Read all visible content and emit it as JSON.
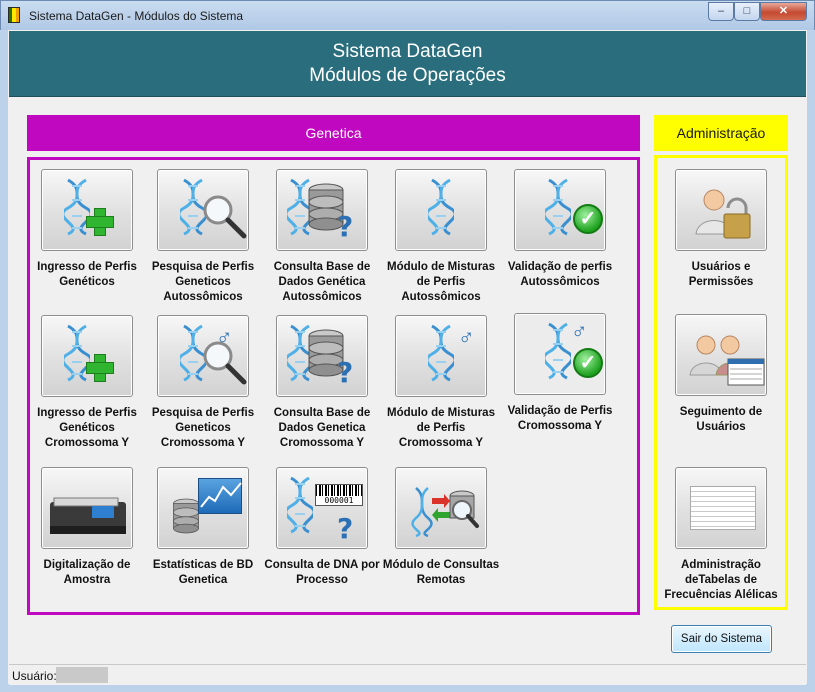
{
  "window": {
    "title": "Sistema DataGen - Módulos do Sistema",
    "controls": {
      "minimize": "–",
      "maximize": "□",
      "close": "✕"
    }
  },
  "header": {
    "line1": "Sistema DataGen",
    "line2": "Módulos de Operações"
  },
  "sections": {
    "genetica": "Genetica",
    "administracao": "Administração"
  },
  "modules": {
    "ingresso_perfis": "Ingresso de Perfis Genéticos",
    "pesquisa_perfis": "Pesquisa de Perfis Geneticos Autossômicos",
    "consulta_base": "Consulta Base de Dados Genética Autossômicos",
    "misturas": "Módulo de Misturas de Perfis Autossômicos",
    "validacao": "Validação de perfis Autossômicos",
    "ingresso_y": "Ingresso de Perfis Genéticos Cromossoma Y",
    "pesquisa_y": "Pesquisa de Perfis Geneticos Cromossoma Y",
    "consulta_y": "Consulta Base de Dados Genetica Cromossoma Y",
    "misturas_y": "Módulo de Misturas de Perfis Cromossoma Y",
    "validacao_y": "Validação de Perfis Cromossoma Y",
    "digitalizacao": "Digitalização de Amostra",
    "estatisticas": "Estatísticas de BD Genetica",
    "consulta_dna": "Consulta de DNA por Processo",
    "consultas_remotas": "Módulo de Consultas Remotas"
  },
  "admin": {
    "usuarios": "Usuários e Permissões",
    "seguimento": "Seguimento de Usuários",
    "tabelas": "Administração deTabelas de Frecuências Alélicas"
  },
  "icons": {
    "barcode_text": "000001"
  },
  "exit_button": "Sair do Sistema",
  "status": {
    "user_label": "Usuário:",
    "user_value": ""
  }
}
